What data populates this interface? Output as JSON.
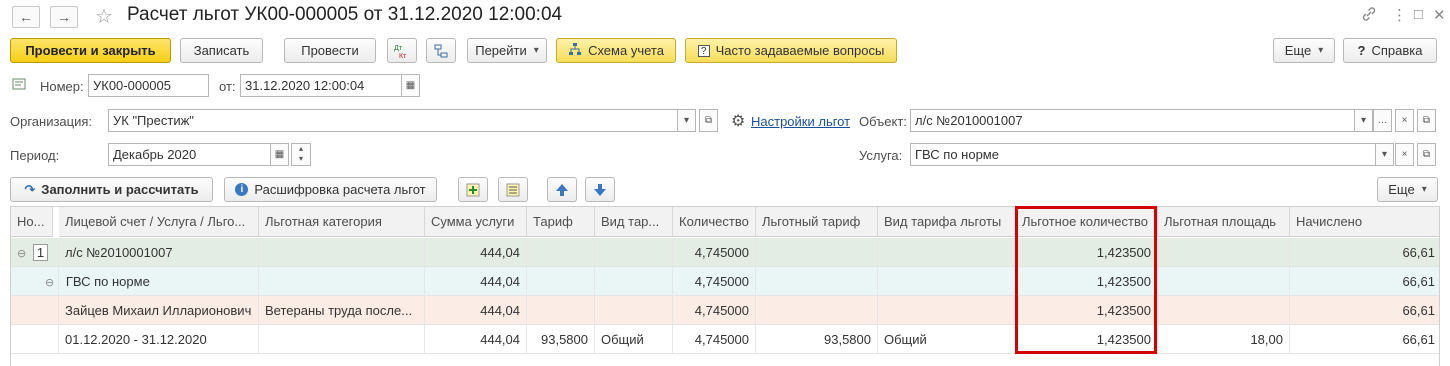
{
  "title": "Расчет льгот УК00-000005 от 31.12.2020 12:00:04",
  "nav": {
    "back": "←",
    "forward": "→",
    "star": "☆"
  },
  "window_icons": {
    "link": "🔗",
    "more": "⋮",
    "restore": "□",
    "close": "✕"
  },
  "toolbar": {
    "post_close": "Провести и закрыть",
    "write": "Записать",
    "post": "Провести",
    "dtkt": "Дт Кт",
    "goto": "Перейти",
    "schema": "Схема учета",
    "faq": "Часто задаваемые вопросы",
    "more": "Еще",
    "help": "Справка"
  },
  "form": {
    "number_label": "Номер:",
    "number_value": "УК00-000005",
    "date_label": "от:",
    "date_value": "31.12.2020 12:00:04",
    "org_label": "Организация:",
    "org_value": "УК \"Престиж\"",
    "settings_link": "Настройки льгот",
    "object_label": "Объект:",
    "object_value": "л/с №2010001007",
    "period_label": "Период:",
    "period_value": "Декабрь 2020",
    "service_label": "Услуга:",
    "service_value": "ГВС по норме"
  },
  "table_toolbar": {
    "fill": "Заполнить и рассчитать",
    "decode": "Расшифровка расчета льгот",
    "more": "Еще"
  },
  "table": {
    "headers": [
      "Но...",
      "Лицевой счет / Услуга / Льго...",
      "Льготная категория",
      "Сумма услуги",
      "Тариф",
      "Вид тар...",
      "Количество",
      "Льготный тариф",
      "Вид тарифа льготы",
      "Льготное количество",
      "Льготная площадь",
      "Начислено"
    ],
    "rows": [
      [
        "1",
        "л/с №2010001007",
        "",
        "444,04",
        "",
        "",
        "4,745000",
        "",
        "",
        "1,423500",
        "",
        "66,61"
      ],
      [
        "",
        "ГВС по норме",
        "",
        "444,04",
        "",
        "",
        "4,745000",
        "",
        "",
        "1,423500",
        "",
        "66,61"
      ],
      [
        "",
        "Зайцев Михаил Илларионович",
        "Ветераны труда после...",
        "444,04",
        "",
        "",
        "4,745000",
        "",
        "",
        "1,423500",
        "",
        "66,61"
      ],
      [
        "",
        "01.12.2020 - 31.12.2020",
        "",
        "444,04",
        "93,5800",
        "Общий",
        "4,745000",
        "93,5800",
        "Общий",
        "1,423500",
        "18,00",
        "66,61"
      ]
    ]
  },
  "colors": {
    "row0": "#e4ede4",
    "row1": "#eaf6f6",
    "row2": "#fbece5",
    "row3": "#ffffff",
    "highlight": "#d40000"
  }
}
